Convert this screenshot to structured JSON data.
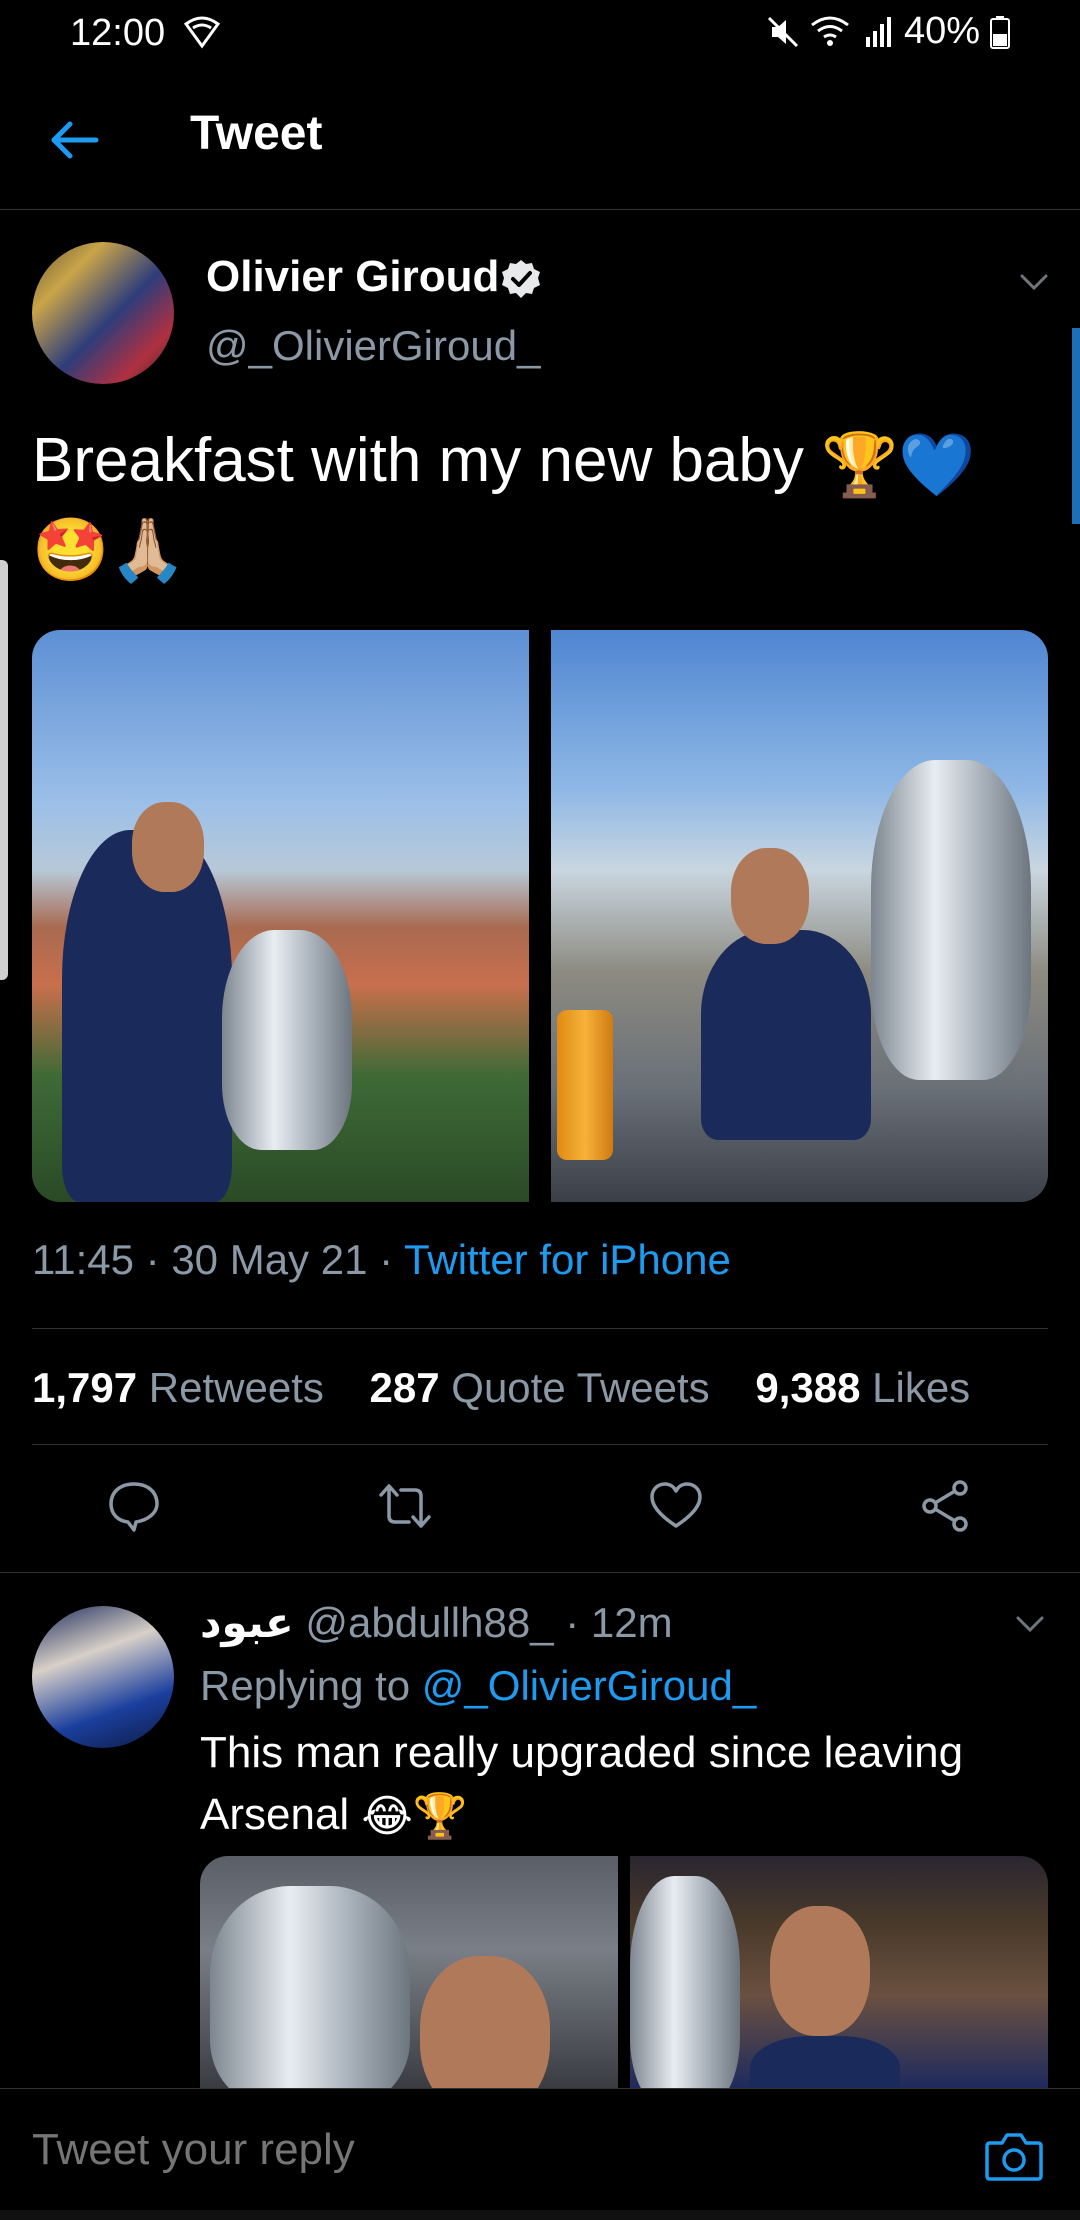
{
  "status_bar": {
    "time": "12:00",
    "battery": "40%",
    "icons": [
      "wifi-icon",
      "mute-icon",
      "signal-icon",
      "battery-icon"
    ]
  },
  "header": {
    "title": "Tweet",
    "back_icon": "arrow-left-icon"
  },
  "tweet": {
    "author_name": "Olivier Giroud",
    "handle": "@_OlivierGiroud_",
    "text": "Breakfast with my new baby ",
    "emojis_line1": "🏆💙",
    "emojis_line2": "🤩🙏🏼",
    "time": "11:45",
    "date": "30 May 21",
    "source": "Twitter for iPhone",
    "separator": " · ",
    "retweets_count": "1,797",
    "retweets_label": "Retweets",
    "quotes_count": "287",
    "quotes_label": "Quote Tweets",
    "likes_count": "9,388",
    "likes_label": "Likes"
  },
  "reply": {
    "name": "عبود",
    "handle": "@abdullh88_",
    "age": "12m",
    "replying_label": "Replying to ",
    "replying_to": "@_OlivierGiroud_",
    "text": "This man really upgraded since leaving Arsenal ",
    "emojis": "😂🏆"
  },
  "composer": {
    "placeholder": "Tweet your reply"
  },
  "colors": {
    "accent": "#1d9bf0",
    "muted": "#8b98a5",
    "background": "#000000",
    "divider": "#2f3336"
  }
}
